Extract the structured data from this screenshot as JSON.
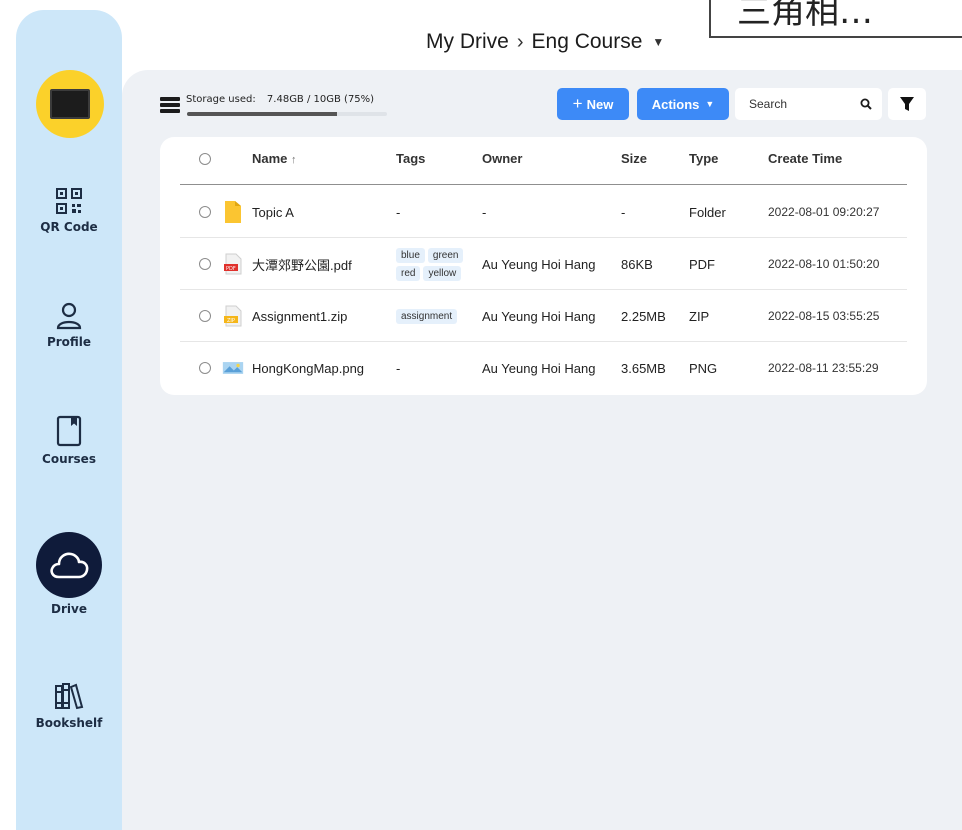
{
  "overlay": {
    "text": "三角相…"
  },
  "sidebar": {
    "items": [
      {
        "label": "QR Code",
        "icon": "qr-code-icon"
      },
      {
        "label": "Profile",
        "icon": "user-icon"
      },
      {
        "label": "Courses",
        "icon": "book-icon"
      },
      {
        "label": "Drive",
        "icon": "cloud-icon"
      },
      {
        "label": "Bookshelf",
        "icon": "bookshelf-icon"
      }
    ],
    "active": "Drive"
  },
  "breadcrumb": {
    "root": "My Drive",
    "separator": "›",
    "current": "Eng Course"
  },
  "storage": {
    "label": "Storage used:",
    "value": "7.48GB / 10GB (75%)",
    "fraction": 0.75
  },
  "toolbar": {
    "new_label": "New",
    "new_icon": "+",
    "actions_label": "Actions",
    "search_placeholder": "Search"
  },
  "table": {
    "headers": {
      "name": "Name",
      "name_sort": "↑",
      "tags": "Tags",
      "owner": "Owner",
      "size": "Size",
      "type": "Type",
      "create_time": "Create Time"
    },
    "rows": [
      {
        "name": "Topic A",
        "icon": "folder-icon",
        "tags_text": "-",
        "tags": [],
        "owner": "-",
        "size": "-",
        "type": "Folder",
        "create_time": "2022-08-01 09:20:27"
      },
      {
        "name": "大潭郊野公園.pdf",
        "icon": "pdf-icon",
        "tags_text": "",
        "tags": [
          "blue",
          "green",
          "red",
          "yellow"
        ],
        "owner": "Au Yeung Hoi Hang",
        "size": "86KB",
        "type": "PDF",
        "create_time": "2022-08-10 01:50:20"
      },
      {
        "name": "Assignment1.zip",
        "icon": "zip-icon",
        "tags_text": "",
        "tags": [
          "assignment"
        ],
        "owner": "Au Yeung Hoi Hang",
        "size": "2.25MB",
        "type": "ZIP",
        "create_time": "2022-08-15 03:55:25"
      },
      {
        "name": "HongKongMap.png",
        "icon": "image-icon",
        "tags_text": "-",
        "tags": [],
        "owner": "Au Yeung Hoi Hang",
        "size": "3.65MB",
        "type": "PNG",
        "create_time": "2022-08-11 23:55:29"
      }
    ]
  },
  "colors": {
    "accent": "#3d8af7",
    "sidebar": "#cde7f9",
    "logo": "#fbd12a",
    "drive_active": "#0f1b3a",
    "background": "#eef1f5"
  }
}
